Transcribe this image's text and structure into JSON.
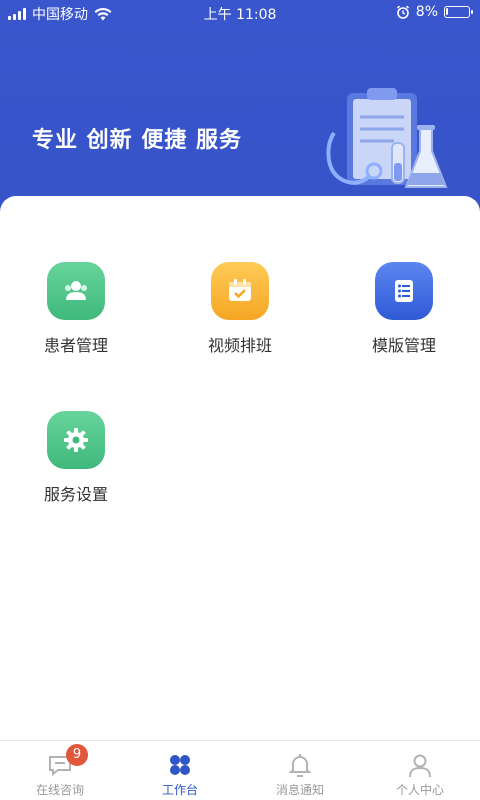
{
  "status_bar": {
    "carrier": "中国移动",
    "time": "上午 11:08",
    "battery": "8%",
    "battery_level": 0.08
  },
  "header": {
    "slogan": "专业 创新 便捷 服务"
  },
  "grid": [
    {
      "label": "患者管理",
      "icon": "patients-icon",
      "color": "#3fb97b"
    },
    {
      "label": "视频排班",
      "icon": "calendar-icon",
      "color": "#f5a623"
    },
    {
      "label": "模版管理",
      "icon": "template-list-icon",
      "color": "#2f5ad6"
    },
    {
      "label": "服务设置",
      "icon": "settings-gear-icon",
      "color": "#3fb97b"
    }
  ],
  "tabbar": {
    "items": [
      {
        "label": "在线咨询",
        "icon": "chat-icon",
        "badge": "9"
      },
      {
        "label": "工作台",
        "icon": "workbench-icon",
        "active": true
      },
      {
        "label": "消息通知",
        "icon": "bell-icon"
      },
      {
        "label": "个人中心",
        "icon": "user-icon"
      }
    ],
    "active_color": "#2f55c6",
    "inactive_color": "#999999"
  }
}
